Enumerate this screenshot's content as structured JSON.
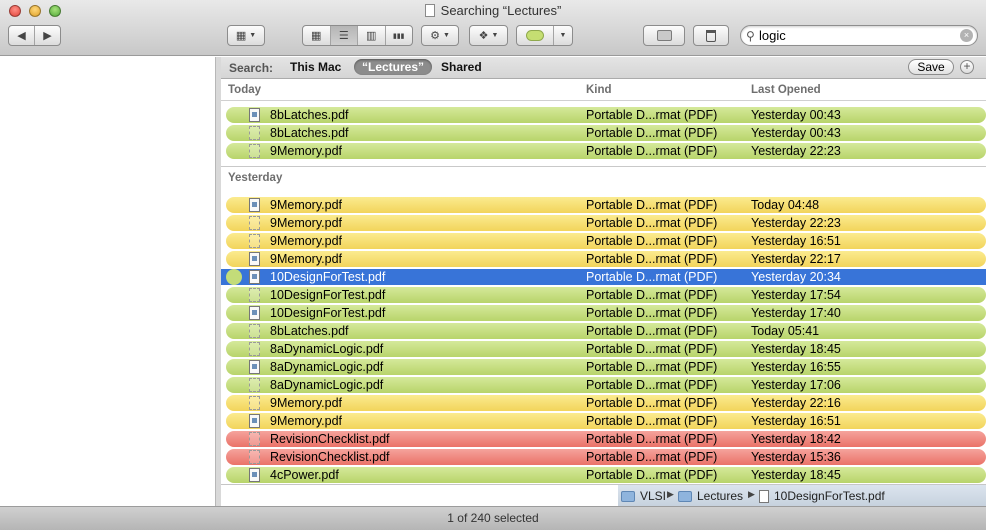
{
  "window": {
    "title": "Searching “Lectures”"
  },
  "search": {
    "value": "logic"
  },
  "scope_bar": {
    "label": "Search:",
    "options": [
      "This Mac",
      "“Lectures”",
      "Shared"
    ],
    "save_label": "Save",
    "add_label": "+"
  },
  "columns": {
    "name": "",
    "kind": "Kind",
    "last_opened": "Last Opened"
  },
  "groups": [
    {
      "title": "Today",
      "rows": [
        {
          "name": "8bLatches.pdf",
          "kind": "Portable D...rmat (PDF)",
          "opened": "Yesterday 00:43",
          "color": "green"
        },
        {
          "name": "8bLatches.pdf",
          "kind": "Portable D...rmat (PDF)",
          "opened": "Yesterday 00:43",
          "color": "green"
        },
        {
          "name": "9Memory.pdf",
          "kind": "Portable D...rmat (PDF)",
          "opened": "Yesterday 22:23",
          "color": "green"
        }
      ]
    },
    {
      "title": "Yesterday",
      "rows": [
        {
          "name": "9Memory.pdf",
          "kind": "Portable D...rmat (PDF)",
          "opened": "Today 04:48",
          "color": "yellow"
        },
        {
          "name": "9Memory.pdf",
          "kind": "Portable D...rmat (PDF)",
          "opened": "Yesterday 22:23",
          "color": "yellow"
        },
        {
          "name": "9Memory.pdf",
          "kind": "Portable D...rmat (PDF)",
          "opened": "Yesterday 16:51",
          "color": "yellow"
        },
        {
          "name": "9Memory.pdf",
          "kind": "Portable D...rmat (PDF)",
          "opened": "Yesterday 22:17",
          "color": "yellow"
        },
        {
          "name": "10DesignForTest.pdf",
          "kind": "Portable D...rmat (PDF)",
          "opened": "Yesterday 20:34",
          "color": "selected"
        },
        {
          "name": "10DesignForTest.pdf",
          "kind": "Portable D...rmat (PDF)",
          "opened": "Yesterday 17:54",
          "color": "green"
        },
        {
          "name": "10DesignForTest.pdf",
          "kind": "Portable D...rmat (PDF)",
          "opened": "Yesterday 17:40",
          "color": "green"
        },
        {
          "name": "8bLatches.pdf",
          "kind": "Portable D...rmat (PDF)",
          "opened": "Today 05:41",
          "color": "green"
        },
        {
          "name": "8aDynamicLogic.pdf",
          "kind": "Portable D...rmat (PDF)",
          "opened": "Yesterday 18:45",
          "color": "green"
        },
        {
          "name": "8aDynamicLogic.pdf",
          "kind": "Portable D...rmat (PDF)",
          "opened": "Yesterday 16:55",
          "color": "green"
        },
        {
          "name": "8aDynamicLogic.pdf",
          "kind": "Portable D...rmat (PDF)",
          "opened": "Yesterday 17:06",
          "color": "green"
        },
        {
          "name": "9Memory.pdf",
          "kind": "Portable D...rmat (PDF)",
          "opened": "Yesterday 22:16",
          "color": "yellow"
        },
        {
          "name": "9Memory.pdf",
          "kind": "Portable D...rmat (PDF)",
          "opened": "Yesterday 16:51",
          "color": "yellow"
        },
        {
          "name": "RevisionChecklist.pdf",
          "kind": "Portable D...rmat (PDF)",
          "opened": "Yesterday 18:42",
          "color": "red"
        },
        {
          "name": "RevisionChecklist.pdf",
          "kind": "Portable D...rmat (PDF)",
          "opened": "Yesterday 15:36",
          "color": "red"
        },
        {
          "name": "4cPower.pdf",
          "kind": "Portable D...rmat (PDF)",
          "opened": "Yesterday 18:45",
          "color": "green"
        }
      ]
    }
  ],
  "path_bar": {
    "items": [
      "VLSI",
      "Lectures",
      "10DesignForTest.pdf"
    ]
  },
  "status": {
    "text": "1 of 240 selected"
  },
  "icons": {
    "back": "◀",
    "forward": "▶",
    "arrange": "▦",
    "view_icon": "▦",
    "view_list": "☰",
    "view_columns": "▥",
    "view_coverflow": "▮▮▮",
    "action": "⚙",
    "dropbox": "❖",
    "tag": "●",
    "new_folder": "📁",
    "trash": "🗑",
    "search": "⚲",
    "clear": "×"
  }
}
